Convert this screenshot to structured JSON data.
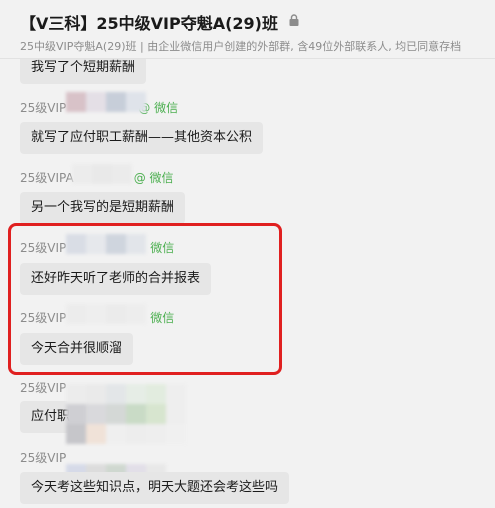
{
  "header": {
    "title": "【V三科】25中级VIP夺魁A(29)班",
    "subtitle": "25中级VIP夺魁A(29)班 | 由企业微信用户创建的外部群, 含49位外部联系人, 均已同意存档",
    "lock_icon": "lock-icon"
  },
  "messages": [
    {
      "sender": "",
      "suffix": "",
      "text": "我写了个短期薪酬"
    },
    {
      "sender": "25级VIP",
      "suffix": "@ 微信",
      "text": "就写了应付职工薪酬——其他资本公积"
    },
    {
      "sender": "25级VIPA",
      "suffix": "@ 微信",
      "text": "另一个我写的是短期薪酬"
    },
    {
      "sender": "25级VIP",
      "suffix": "微信",
      "text": "还好昨天听了老师的合并报表"
    },
    {
      "sender": "25级VIP",
      "suffix": "微信",
      "text": "今天合并很顺溜"
    },
    {
      "sender": "25级VIP",
      "suffix": "",
      "text": "应付职"
    },
    {
      "sender": "25级VIP",
      "suffix": "",
      "text": "今天考这些知识点，明天大题还会考这些吗"
    }
  ],
  "colors": {
    "background": "#f2f2f2",
    "bubble": "#e6e6e6",
    "wechat_green": "#4caf50",
    "highlight_border": "#e02020"
  }
}
